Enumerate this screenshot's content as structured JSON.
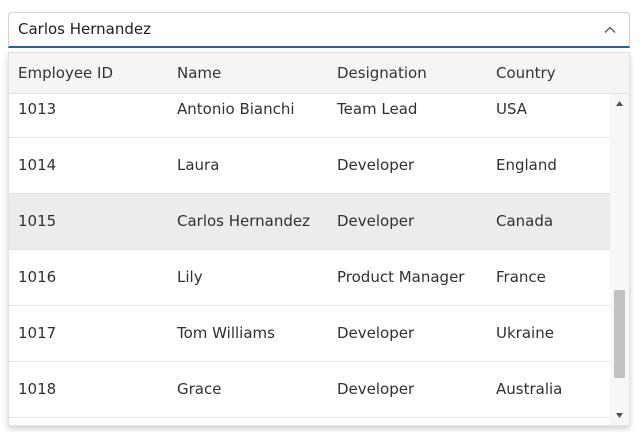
{
  "combobox": {
    "value": "Carlos Hernandez",
    "toggle_icon": "chevron-up-icon"
  },
  "grid": {
    "columns": [
      "Employee ID",
      "Name",
      "Designation",
      "Country"
    ],
    "rows": [
      [
        "1013",
        "Antonio Bianchi",
        "Team Lead",
        "USA"
      ],
      [
        "1014",
        "Laura",
        "Developer",
        "England"
      ],
      [
        "1015",
        "Carlos Hernandez",
        "Developer",
        "Canada"
      ],
      [
        "1016",
        "Lily",
        "Product Manager",
        "France"
      ],
      [
        "1017",
        "Tom Williams",
        "Developer",
        "Ukraine"
      ],
      [
        "1018",
        "Grace",
        "Developer",
        "Australia"
      ]
    ],
    "selected_row": 2
  },
  "scrollbar": {
    "up_icon": "triangle-up-icon",
    "down_icon": "triangle-down-icon"
  },
  "colors": {
    "focus_border": "#1f5fbf",
    "header_bg": "#f5f5f5",
    "selected_bg": "#ececec",
    "thumb": "#c2c2c2"
  }
}
